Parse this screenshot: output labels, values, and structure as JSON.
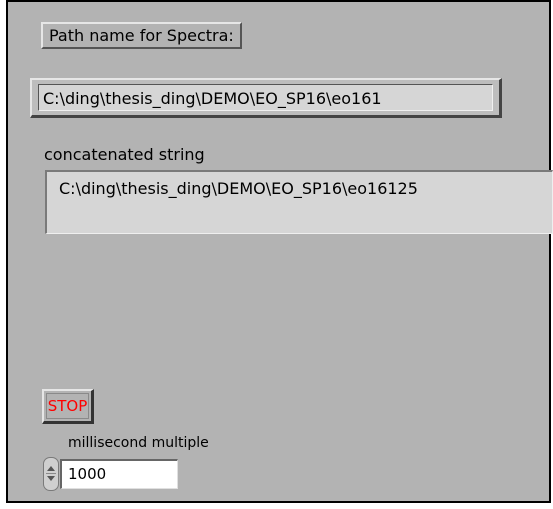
{
  "path_label": "Path name for Spectra:",
  "path_value": "C:\\ding\\thesis_ding\\DEMO\\EO_SP16\\eo161",
  "concat_label": "concatenated string",
  "concat_value": "C:\\ding\\thesis_ding\\DEMO\\EO_SP16\\eo16125",
  "stop_label": "STOP",
  "ms_label": "millisecond multiple",
  "ms_value": "1000",
  "colors": {
    "panel": "#b3b3b3",
    "stop_text": "#ff0000",
    "string_field": "#d6d6d6",
    "numeric_field": "#ffffff"
  },
  "icons": {
    "stepper": "increment-decrement-arrows"
  }
}
